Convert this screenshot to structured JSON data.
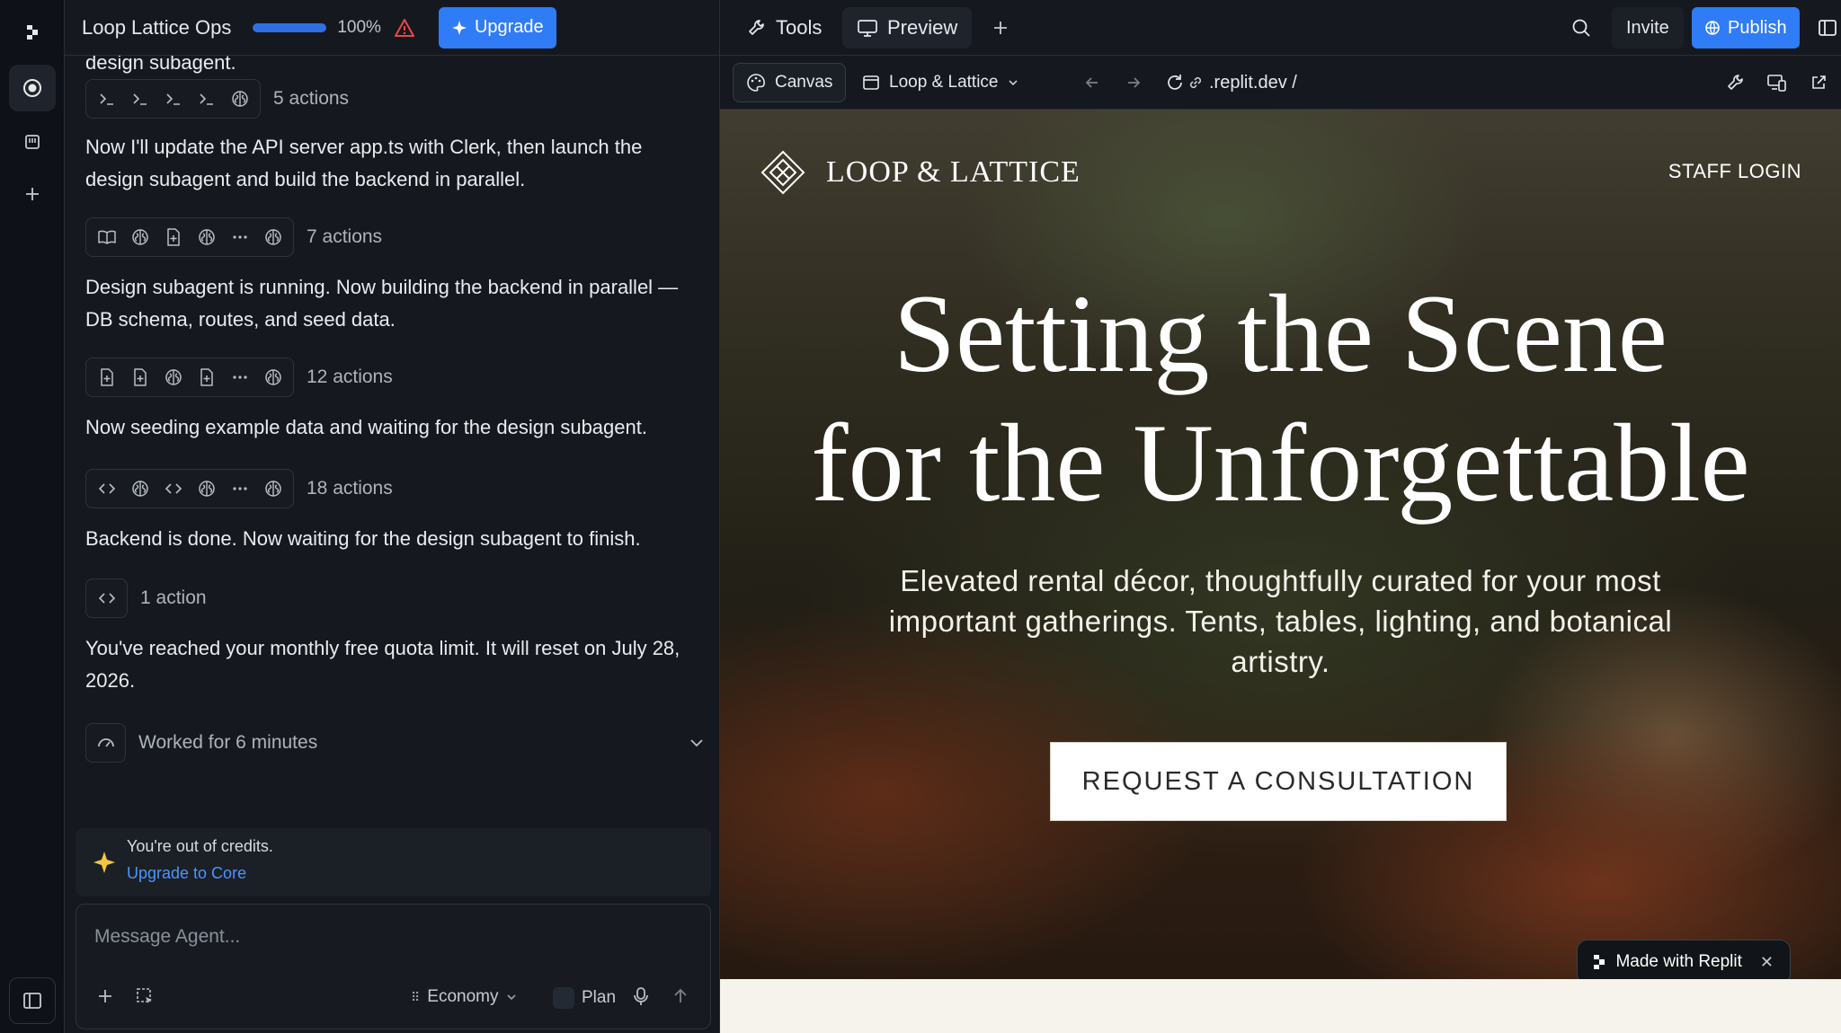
{
  "app": {
    "project_name": "Loop Lattice Ops",
    "progress_percent": 100,
    "progress_label": "100%",
    "upgrade_label": "Upgrade"
  },
  "chat": {
    "messages": [
      "design subagent.",
      "Now I'll update the API server app.ts with Clerk, then launch the design subagent and build the backend in parallel.",
      "Design subagent is running. Now building the backend in parallel — DB schema, routes, and seed data.",
      "Now seeding example data and waiting for the design subagent.",
      "Backend is done. Now waiting for the design subagent to finish.",
      "You've reached your monthly free quota limit. It will reset on July 28, 2026."
    ],
    "action_groups": [
      {
        "label": "5 actions",
        "icons": [
          "terminal-icon",
          "terminal-icon",
          "terminal-icon",
          "terminal-icon",
          "brain-icon"
        ]
      },
      {
        "label": "7 actions",
        "icons": [
          "book-icon",
          "brain-icon",
          "file-plus-icon",
          "brain-icon",
          "more-icon",
          "brain-icon"
        ]
      },
      {
        "label": "12 actions",
        "icons": [
          "file-plus-icon",
          "file-plus-icon",
          "brain-icon",
          "file-plus-icon",
          "more-icon",
          "brain-icon"
        ]
      },
      {
        "label": "18 actions",
        "icons": [
          "code-icon",
          "brain-icon",
          "code-icon",
          "brain-icon",
          "more-icon",
          "brain-icon"
        ]
      },
      {
        "label": "1 action",
        "icons": [
          "code-icon"
        ]
      }
    ],
    "worked_label": "Worked for 6 minutes",
    "credits": {
      "title": "You're out of credits.",
      "link": "Upgrade to Core"
    },
    "composer": {
      "placeholder": "Message Agent...",
      "mode": "Economy",
      "plan_label": "Plan"
    }
  },
  "workspace": {
    "tabs": [
      "Tools",
      "Preview"
    ],
    "invite_label": "Invite",
    "publish_label": "Publish",
    "canvas_label": "Canvas",
    "project_select": "Loop & Lattice",
    "url": ".replit.dev /"
  },
  "site": {
    "brand": "LOOP & LATTICE",
    "staff_login": "STAFF LOGIN",
    "title_line1": "Setting the Scene",
    "title_line2": "for the Unforgettable",
    "subtitle": "Elevated rental décor, thoughtfully curated for your most important gatherings. Tents, tables, lighting, and botanical artistry.",
    "cta": "REQUEST A CONSULTATION",
    "badge": "Made with Replit"
  },
  "colors": {
    "accent": "#2f7cf6",
    "link": "#4b95ff",
    "warning": "#e5484d",
    "credits_star": "#f5c542"
  }
}
